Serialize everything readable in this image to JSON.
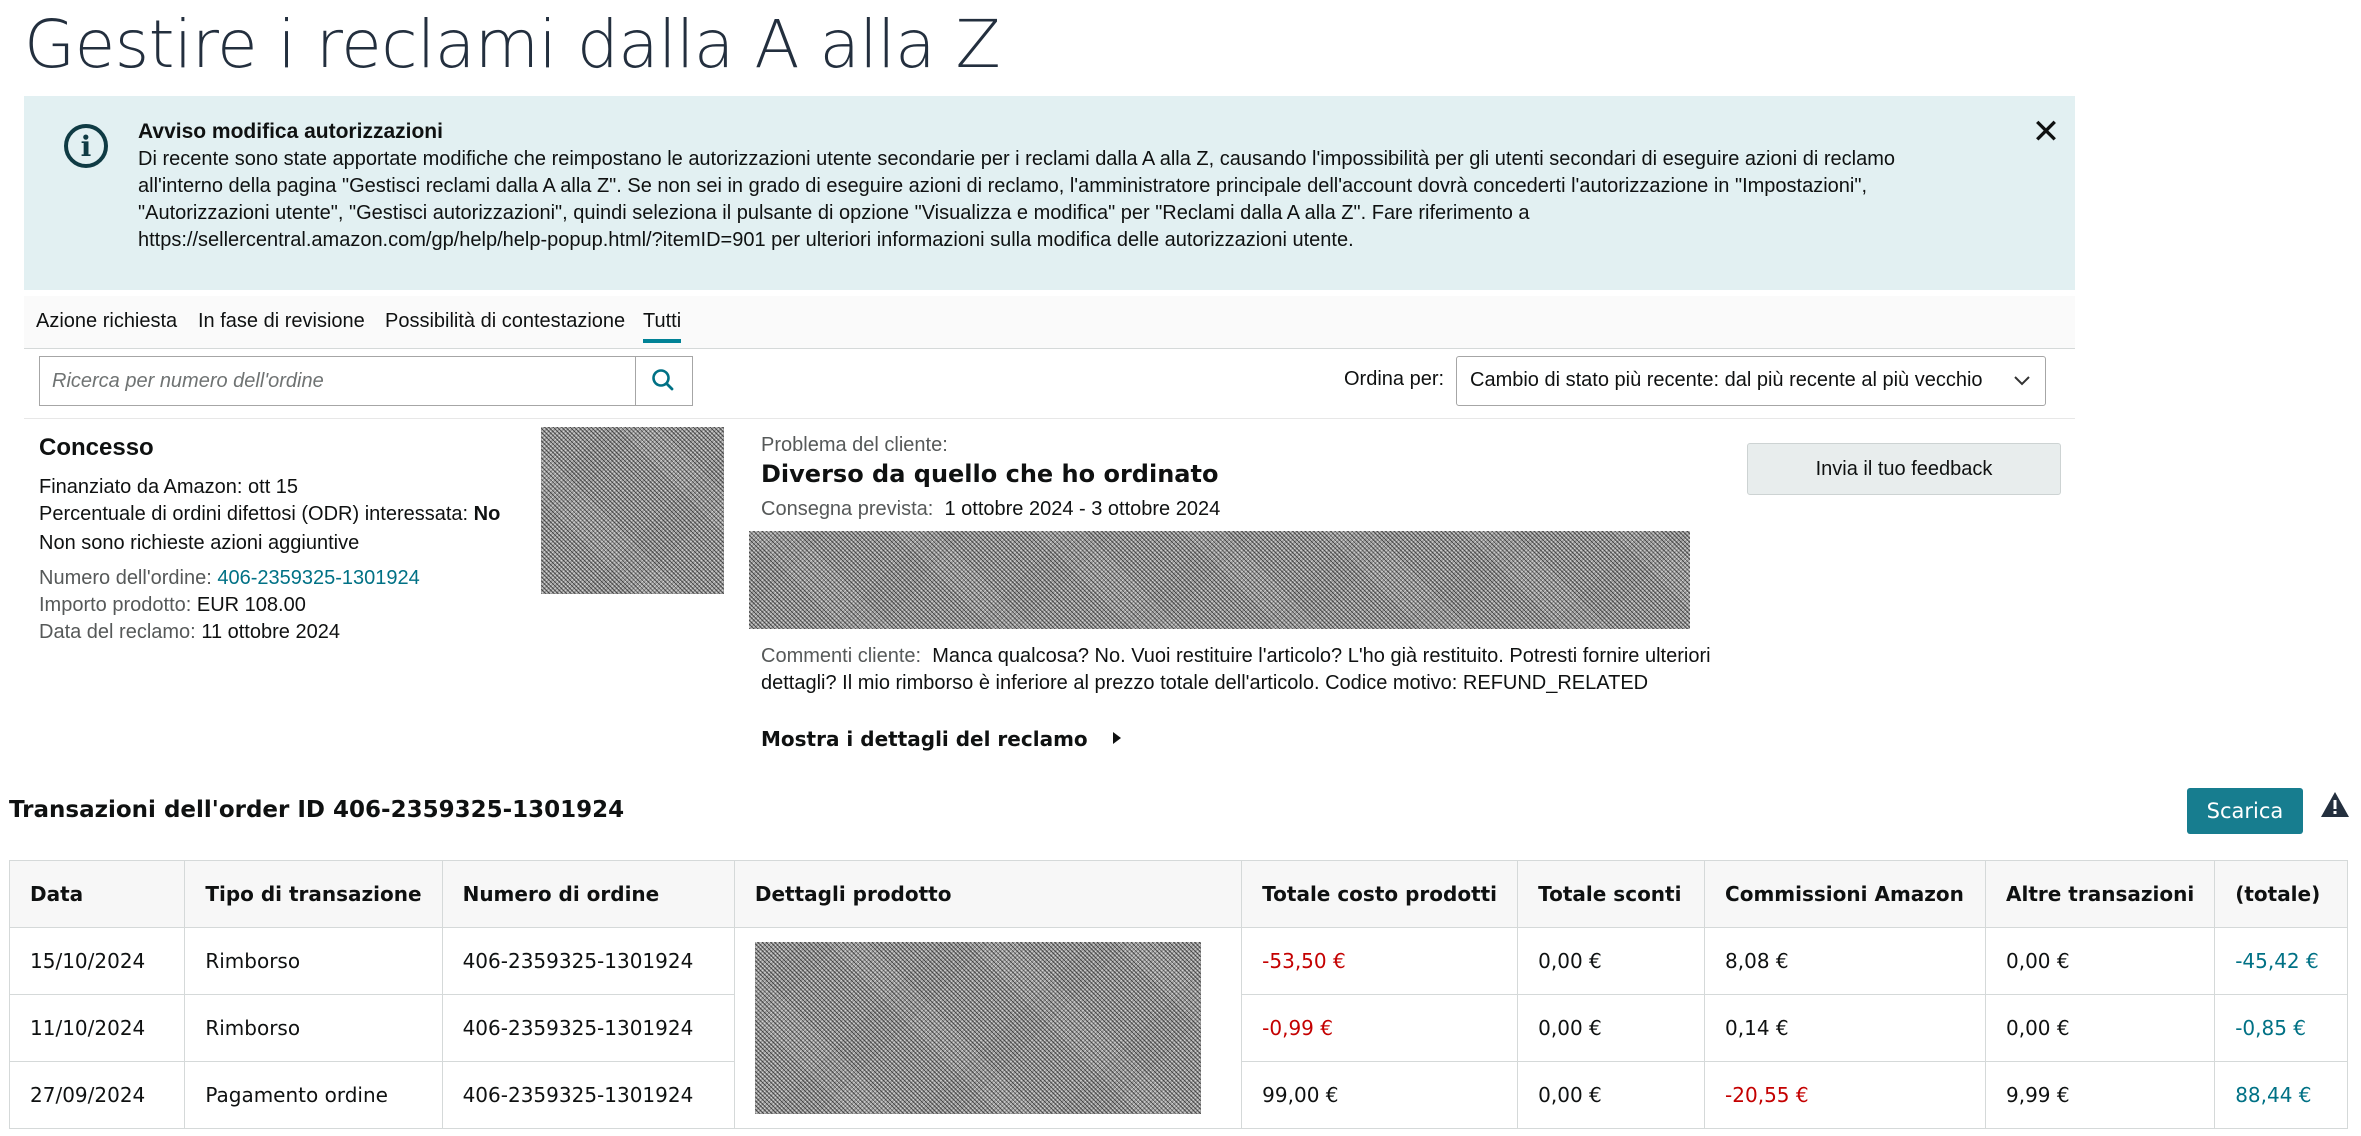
{
  "page": {
    "title": "Gestire i reclami dalla A alla Z"
  },
  "alert": {
    "title": "Avviso modifica autorizzazioni",
    "lines": [
      "Di recente sono state apportate modifiche che reimpostano le autorizzazioni utente secondarie per i reclami dalla A alla Z, causando l'impossibilità per gli utenti secondari di eseguire azioni di reclamo",
      "all'interno della pagina \"Gestisci reclami dalla A alla Z\". Se non sei in grado di eseguire azioni di reclamo, l'amministratore principale dell'account dovrà concederti l'autorizzazione in \"Impostazioni\",",
      "\"Autorizzazioni utente\", \"Gestisci autorizzazioni\", quindi seleziona il pulsante di opzione \"Visualizza e modifica\" per \"Reclami dalla A alla Z\". Fare riferimento a",
      "https://sellercentral.amazon.com/gp/help/help-popup.html/?itemID=901 per ulteriori informazioni sulla modifica delle autorizzazioni utente."
    ],
    "icon": "info-icon",
    "close_icon": "close-icon"
  },
  "tabs": [
    {
      "label": "Azione richiesta"
    },
    {
      "label": "In fase di revisione"
    },
    {
      "label": "Possibilità di contestazione"
    },
    {
      "label": "Tutti",
      "active": true
    }
  ],
  "search": {
    "placeholder": "Ricerca per numero dell'ordine",
    "icon": "search-icon"
  },
  "sort": {
    "label": "Ordina per:",
    "selected": "Cambio di stato più recente: dal più recente al più vecchio"
  },
  "claim": {
    "status": "Concesso",
    "funded": "Finanziato da Amazon: ott 15",
    "odr_label": "Percentuale di ordini difettosi (ODR) interessata:",
    "odr_value": "No",
    "no_action": "Non sono richieste azioni aggiuntive",
    "order_label": "Numero dell'ordine:",
    "order_value": "406-2359325-1301924",
    "amount_label": "Importo prodotto:",
    "amount_value": "EUR 108.00",
    "date_label": "Data del reclamo:",
    "date_value": "11 ottobre 2024",
    "problem_label": "Problema del cliente:",
    "problem_value": "Diverso da quello che ho ordinato",
    "delivery_label": "Consegna prevista:",
    "delivery_value": "1 ottobre 2024 - 3 ottobre 2024",
    "comments_label": "Commenti cliente:",
    "comments_line1": "Manca qualcosa? No. Vuoi restituire l'articolo? L'ho già restituito. Potresti fornire ulteriori",
    "comments_line2": "dettagli? Il mio rimborso è inferiore al prezzo totale dell'articolo. Codice motivo: REFUND_RELATED",
    "feedback_button": "Invia il tuo feedback",
    "details_toggle": "Mostra i dettagli del reclamo",
    "details_icon": "caret-right-icon"
  },
  "transactions": {
    "title": "Transazioni dell'order ID 406-2359325-1301924",
    "download_label": "Scarica",
    "warning_icon": "warning-icon",
    "columns": [
      "Data",
      "Tipo di transazione",
      "Numero di ordine",
      "Dettagli prodotto",
      "Totale costo prodotti",
      "Totale sconti",
      "Commissioni Amazon",
      "Altre transazioni",
      "(totale)"
    ],
    "rows": [
      {
        "date": "15/10/2024",
        "type": "Rimborso",
        "order": "406-2359325-1301924",
        "product_cost": "-53,50 €",
        "discounts": "0,00 €",
        "fees": "8,08 €",
        "other": "0,00 €",
        "total": "-45,42 €"
      },
      {
        "date": "11/10/2024",
        "type": "Rimborso",
        "order": "406-2359325-1301924",
        "product_cost": "-0,99 €",
        "discounts": "0,00 €",
        "fees": "0,14 €",
        "other": "0,00 €",
        "total": "-0,85 €"
      },
      {
        "date": "27/09/2024",
        "type": "Pagamento ordine",
        "order": "406-2359325-1301924",
        "product_cost": "99,00 €",
        "discounts": "0,00 €",
        "fees": "-20,55 €",
        "other": "9,99 €",
        "total": "88,44 €"
      }
    ]
  },
  "colors": {
    "accent": "#008296",
    "button": "#177d8f",
    "negative": "#c40000",
    "link": "#007185",
    "alert_bg": "#e2f0f2"
  }
}
